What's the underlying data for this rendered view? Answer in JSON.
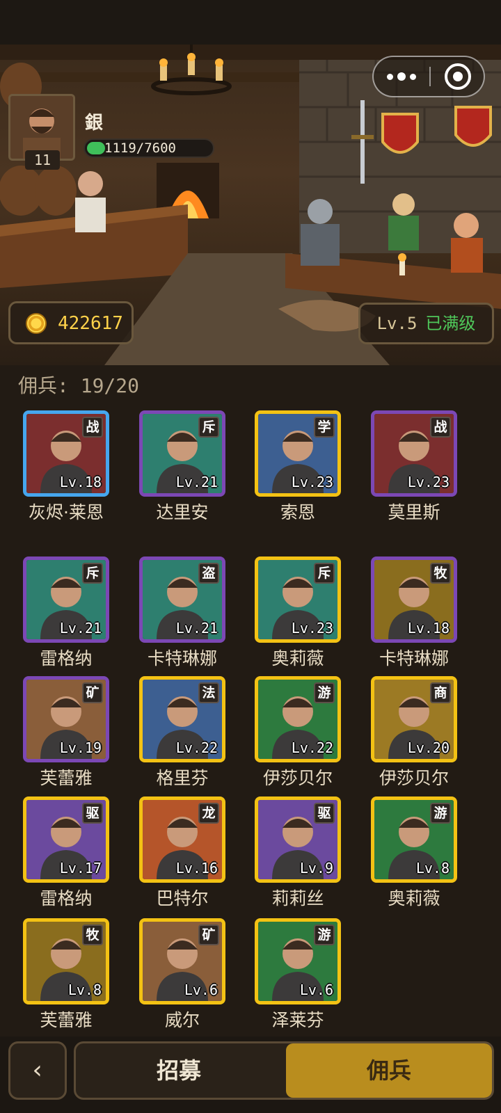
{
  "player": {
    "name": "銀",
    "level": "11",
    "xp_text": "1119/7600",
    "xp_progress": 0.147
  },
  "banner": {
    "gold": "422617",
    "tavern_level": "Lv.5",
    "tavern_status": "已满级",
    "mini_menu_icon": "more-dots-icon",
    "mini_close_icon": "target-close-icon"
  },
  "roster": {
    "count_label": "佣兵: 19/20",
    "heroes": [
      {
        "name": "灰烬·莱恩",
        "cls": "战",
        "level": "Lv.18",
        "rarity": "blue",
        "bg": "#7b2e2e"
      },
      {
        "name": "达里安",
        "cls": "斥",
        "level": "Lv.21",
        "rarity": "purple",
        "bg": "#2e7f6f"
      },
      {
        "name": "索恩",
        "cls": "学",
        "level": "Lv.23",
        "rarity": "gold",
        "bg": "#3d5f91"
      },
      {
        "name": "莫里斯",
        "cls": "战",
        "level": "Lv.23",
        "rarity": "purple",
        "bg": "#7b2e2e"
      },
      {
        "name": "雷格纳",
        "cls": "斥",
        "level": "Lv.21",
        "rarity": "purple",
        "bg": "#2e7f6f"
      },
      {
        "name": "卡特琳娜",
        "cls": "盗",
        "level": "Lv.21",
        "rarity": "purple",
        "bg": "#2e7f6f"
      },
      {
        "name": "奥莉薇",
        "cls": "斥",
        "level": "Lv.23",
        "rarity": "gold",
        "bg": "#2e7f6f"
      },
      {
        "name": "卡特琳娜",
        "cls": "牧",
        "level": "Lv.18",
        "rarity": "purple",
        "bg": "#8a6d1e"
      },
      {
        "name": "芙蕾雅",
        "cls": "矿",
        "level": "Lv.19",
        "rarity": "purple",
        "bg": "#8a5e3a"
      },
      {
        "name": "格里芬",
        "cls": "法",
        "level": "Lv.22",
        "rarity": "gold",
        "bg": "#3d5f91"
      },
      {
        "name": "伊莎贝尔",
        "cls": "游",
        "level": "Lv.22",
        "rarity": "gold",
        "bg": "#2d7a3e"
      },
      {
        "name": "伊莎贝尔",
        "cls": "商",
        "level": "Lv.20",
        "rarity": "gold",
        "bg": "#9c7a24"
      },
      {
        "name": "雷格纳",
        "cls": "驱",
        "level": "Lv.17",
        "rarity": "gold",
        "bg": "#6b4a9e"
      },
      {
        "name": "巴特尔",
        "cls": "龙",
        "level": "Lv.16",
        "rarity": "gold",
        "bg": "#b5552a"
      },
      {
        "name": "莉莉丝",
        "cls": "驱",
        "level": "Lv.9",
        "rarity": "gold",
        "bg": "#6b4a9e"
      },
      {
        "name": "奥莉薇",
        "cls": "游",
        "level": "Lv.8",
        "rarity": "gold",
        "bg": "#2d7a3e"
      },
      {
        "name": "芙蕾雅",
        "cls": "牧",
        "level": "Lv.8",
        "rarity": "gold",
        "bg": "#8a6d1e"
      },
      {
        "name": "威尔",
        "cls": "矿",
        "level": "Lv.6",
        "rarity": "gold",
        "bg": "#8a5e3a"
      },
      {
        "name": "泽莱芬",
        "cls": "游",
        "level": "Lv.6",
        "rarity": "gold",
        "bg": "#2d7a3e"
      }
    ]
  },
  "nav": {
    "back_icon": "chevron-left-icon",
    "tab_recruit": "招募",
    "tab_mercenary": "佣兵"
  },
  "colors": {
    "accent_gold": "#b98d1e",
    "rarity_blue": "#46a6ee",
    "rarity_purple": "#7c48b5",
    "rarity_gold": "#f3c214",
    "xp_green": "#3fbf5a"
  }
}
